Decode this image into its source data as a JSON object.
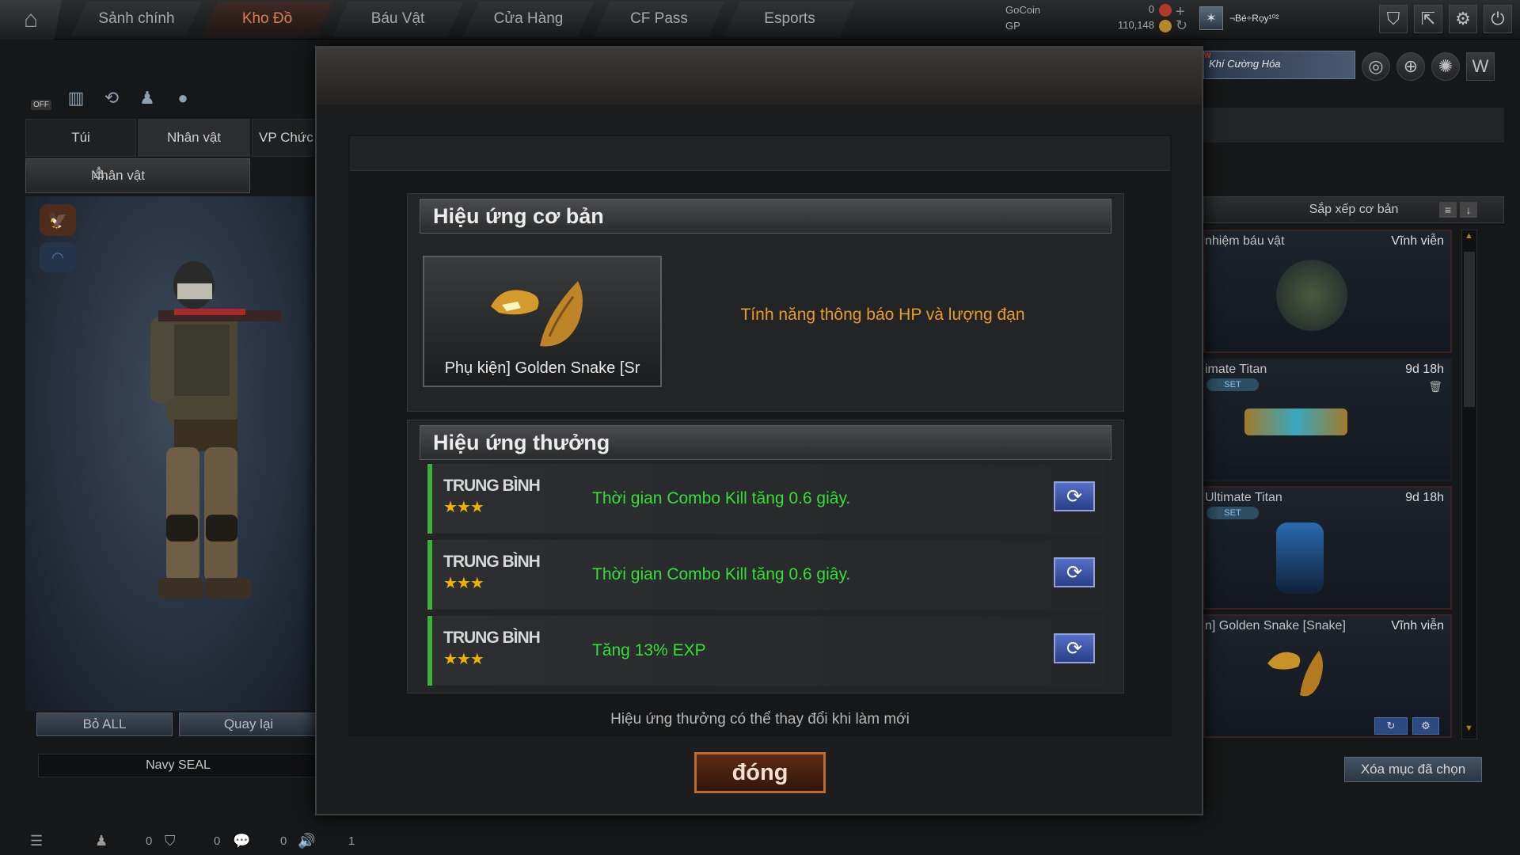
{
  "topbar": {
    "home_icon": "home-icon",
    "nav": [
      "Sảnh chính",
      "Kho Đồ",
      "Báu Vật",
      "Cửa Hàng",
      "CF Pass",
      "Esports"
    ],
    "active_nav": "Kho Đồ",
    "currency": {
      "gocoin_label": "GoCoin",
      "gocoin_value": "0",
      "gp_label": "GP",
      "gp_value": "110,148"
    },
    "profile_name": "¬Bé÷Rọy¹⁰²",
    "right_icons": [
      "shield-icon",
      "exit-icon",
      "gear-icon",
      "power-icon"
    ]
  },
  "left_panel": {
    "quick_icons": [
      "toggle-off-icon",
      "stats-icon",
      "history-icon",
      "character-icon",
      "grenade-icon"
    ],
    "off_label": "OFF",
    "tabs": [
      "Túi",
      "Nhân vật",
      "VP Chức"
    ],
    "subtab": "Nhân vật",
    "button_remove_all": "Bỏ ALL",
    "button_back": "Quay lại",
    "character_name": "Navy SEAL",
    "status_counts": [
      "0",
      "0",
      "0",
      "1"
    ]
  },
  "banner": {
    "label": "Khí Cường Hóa"
  },
  "right_panel": {
    "sort_label": "Sắp xếp cơ bản",
    "items": [
      {
        "name": "nhiệm báu vật",
        "duration": "Vĩnh viễn",
        "set": ""
      },
      {
        "name": "imate Titan",
        "duration": "9d 18h",
        "set": "SET"
      },
      {
        "name": "Ultimate Titan",
        "duration": "9d 18h",
        "set": "SET"
      },
      {
        "name": "n] Golden Snake [Snake]",
        "duration": "Vĩnh viễn",
        "set": ""
      }
    ],
    "delete_selected": "Xóa mục đã chọn"
  },
  "modal": {
    "basic_title": "Hiệu ứng cơ bản",
    "item_name": "Phụ kiện] Golden Snake [Sr",
    "basic_effect": "Tính năng thông báo HP và lượng đạn",
    "bonus_title": "Hiệu ứng thưởng",
    "bonus_rows": [
      {
        "grade": "TRUNG BÌNH",
        "stars": "★★★",
        "desc": "Thời gian Combo Kill tăng 0.6 giây."
      },
      {
        "grade": "TRUNG BÌNH",
        "stars": "★★★",
        "desc": "Thời gian Combo Kill tăng 0.6 giây."
      },
      {
        "grade": "TRUNG BÌNH",
        "stars": "★★★",
        "desc": "Tăng 13% EXP"
      }
    ],
    "hint": "Hiệu ứng thưởng có thể thay đổi khi làm mới",
    "close_label": "đóng"
  },
  "colors": {
    "accent_orange": "#e89a2a",
    "bonus_green": "#34e034",
    "active_nav": "#e07a50",
    "refresh_blue": "#4a63c0"
  }
}
